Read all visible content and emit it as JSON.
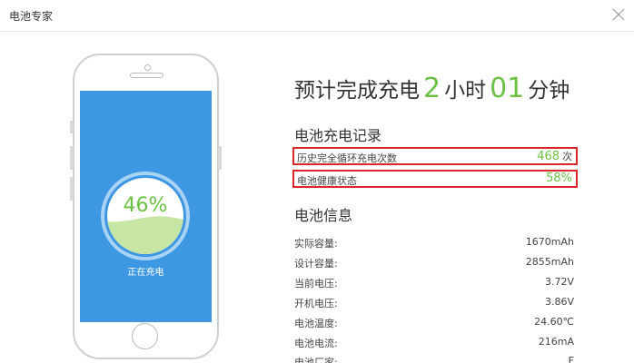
{
  "window": {
    "title": "电池专家",
    "close_icon": "close-icon"
  },
  "phone": {
    "battery_percent_label": "46%",
    "battery_fill": 0.46,
    "status_label": "正在充电",
    "colors": {
      "screen": "#3d97e3",
      "fill": "#c8e6a3",
      "accent": "#6cc046"
    }
  },
  "estimate": {
    "prefix": "预计完成充电",
    "hours": "2",
    "hours_unit": "小时",
    "minutes": "01",
    "minutes_unit": "分钟"
  },
  "record": {
    "title": "电池充电记录",
    "rows": [
      {
        "label": "历史完全循环充电次数",
        "value": "468",
        "unit": "次"
      },
      {
        "label": "电池健康状态",
        "value": "58%",
        "unit": ""
      }
    ],
    "highlight_color": "#d9282b"
  },
  "info": {
    "title": "电池信息",
    "rows": [
      {
        "label": "实际容量:",
        "value": "1670mAh"
      },
      {
        "label": "设计容量:",
        "value": "2855mAh"
      },
      {
        "label": "当前电压:",
        "value": "3.72V"
      },
      {
        "label": "开机电压:",
        "value": "3.86V"
      },
      {
        "label": "电池温度:",
        "value": "24.60℃"
      },
      {
        "label": "电池电流:",
        "value": "216mA"
      },
      {
        "label": "电池厂家:",
        "value": "F"
      }
    ]
  }
}
